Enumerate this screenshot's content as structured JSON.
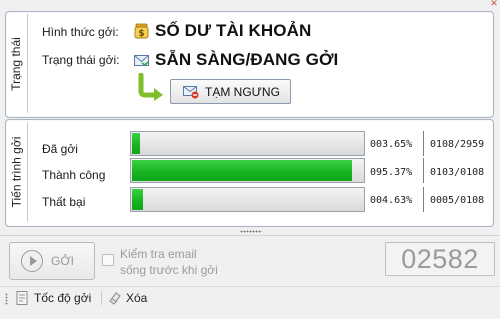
{
  "status": {
    "group_label": "Trạng thái",
    "mode_label": "Hình thức gởi:",
    "mode_value": "SỐ DƯ TÀI KHOẢN",
    "mode_icon": "coin-jar-icon",
    "state_label": "Trạng thái gởi:",
    "state_value": "SẴN SÀNG/ĐANG GỞI",
    "state_icon": "envelope-icon",
    "pause_button_label": "TẠM NGƯNG",
    "pause_icon": "mail-stop-icon"
  },
  "progress": {
    "group_label": "Tiến trình gởi",
    "rows": [
      {
        "label": "Đã gởi",
        "fraction": 0.0365,
        "percent": "003.65%",
        "count": "0108/2959"
      },
      {
        "label": "Thành công",
        "fraction": 0.9537,
        "percent": "095.37%",
        "count": "0103/0108"
      },
      {
        "label": "Thất bại",
        "fraction": 0.0463,
        "percent": "004.63%",
        "count": "0005/0108"
      }
    ],
    "fill_color": "#17b421"
  },
  "controls": {
    "send_label": "GỞI",
    "check_label_line1": "Kiểm tra email",
    "check_label_line2": "sống trước khi gởi",
    "check_checked": false,
    "counter": "02582"
  },
  "toolbar": {
    "speed_label": "Tốc độ gởi",
    "delete_label": "Xóa"
  }
}
